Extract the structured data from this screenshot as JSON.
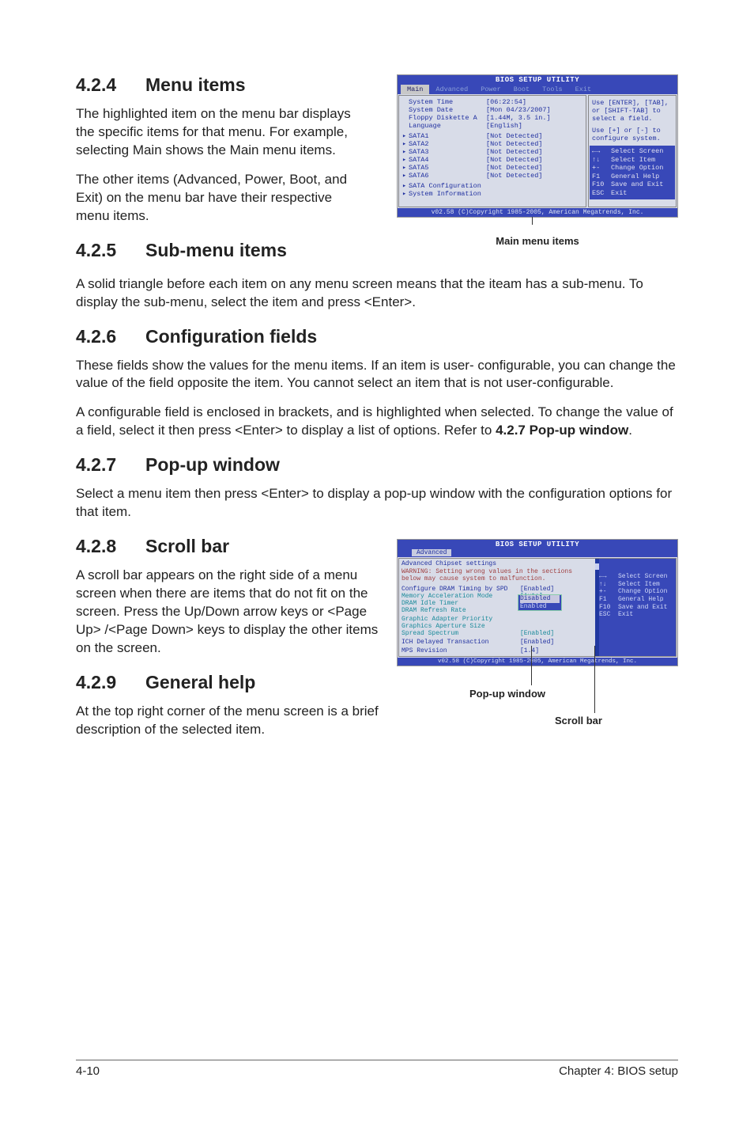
{
  "sections": {
    "s424": {
      "num": "4.2.4",
      "title": "Menu items",
      "p1": "The highlighted item on the menu bar displays the specific items for that menu. For example, selecting Main shows the Main menu items.",
      "p2": "The other items (Advanced, Power, Boot, and Exit) on the menu bar have their respective menu items."
    },
    "s425": {
      "num": "4.2.5",
      "title": "Sub-menu items",
      "p1": "A solid triangle before each item on any menu screen means that the iteam has a sub-menu. To display the sub-menu, select the item and press <Enter>."
    },
    "s426": {
      "num": "4.2.6",
      "title": "Configuration fields",
      "p1": "These fields show the values for the menu items. If an item is user- configurable, you can change the value of the field opposite the item. You cannot select an item that is not user-configurable.",
      "p2_a": "A configurable field is enclosed in brackets, and is highlighted when selected. To change the value of a field, select it then press <Enter> to display a list of options. Refer to ",
      "p2_b": "4.2.7 Pop-up window",
      "p2_c": "."
    },
    "s427": {
      "num": "4.2.7",
      "title": "Pop-up window",
      "p1": "Select a menu item then press <Enter> to display a pop-up window with the configuration options for that item."
    },
    "s428": {
      "num": "4.2.8",
      "title": "Scroll bar",
      "p1": "A scroll bar appears on the right side of a menu screen when there are items that do not fit on the screen. Press the Up/Down arrow keys or <Page Up> /<Page Down> keys to display the other items on the screen."
    },
    "s429": {
      "num": "4.2.9",
      "title": "General help",
      "p1": "At the top right corner of the menu screen is a brief description of the selected item."
    }
  },
  "bios1": {
    "title": "BIOS SETUP UTILITY",
    "tabs": [
      "Main",
      "Advanced",
      "Power",
      "Boot",
      "Tools",
      "Exit"
    ],
    "rows": [
      {
        "tri": "",
        "lbl": "System Time",
        "val": "[06:22:54]"
      },
      {
        "tri": "",
        "lbl": "System Date",
        "val": "[Mon 04/23/2007]"
      },
      {
        "tri": "",
        "lbl": "Floppy Diskette A",
        "val": "[1.44M, 3.5 in.]"
      },
      {
        "tri": "",
        "lbl": "Language",
        "val": "[English]"
      },
      {
        "tri": "▸",
        "lbl": "SATA1",
        "val": "[Not Detected]"
      },
      {
        "tri": "▸",
        "lbl": "SATA2",
        "val": "[Not Detected]"
      },
      {
        "tri": "▸",
        "lbl": "SATA3",
        "val": "[Not Detected]"
      },
      {
        "tri": "▸",
        "lbl": "SATA4",
        "val": "[Not Detected]"
      },
      {
        "tri": "▸",
        "lbl": "SATA5",
        "val": "[Not Detected]"
      },
      {
        "tri": "▸",
        "lbl": "SATA6",
        "val": "[Not Detected]"
      },
      {
        "tri": "▸",
        "lbl": "SATA Configuration",
        "val": ""
      },
      {
        "tri": "▸",
        "lbl": "System Information",
        "val": ""
      }
    ],
    "help1": "Use [ENTER], [TAB], or [SHIFT-TAB] to select a field.",
    "help2": "Use [+] or [-] to configure system.",
    "keys": [
      {
        "k": "←→",
        "d": "Select Screen"
      },
      {
        "k": "↑↓",
        "d": "Select Item"
      },
      {
        "k": "+-",
        "d": "Change Option"
      },
      {
        "k": "F1",
        "d": "General Help"
      },
      {
        "k": "F10",
        "d": "Save and Exit"
      },
      {
        "k": "ESC",
        "d": "Exit"
      }
    ],
    "footer": "v02.58 (C)Copyright 1985-2005, American Megatrends, Inc.",
    "caption": "Main menu items"
  },
  "bios2": {
    "title": "BIOS SETUP UTILITY",
    "tab": "Advanced",
    "heading": "Advanced Chipset settings",
    "warning": "WARNING: Setting wrong values in the sections below may cause system to malfunction.",
    "rows": [
      {
        "lbl": "Configure DRAM Timing by SPD",
        "val": "[Enabled]",
        "cls": ""
      },
      {
        "lbl": "Memory Acceleration Mode",
        "val": "[Auto]",
        "cls": "cyan"
      },
      {
        "lbl": "DRAM Idle Timer",
        "val": "",
        "cls": "cyan"
      },
      {
        "lbl": "DRAM Refresh Rate",
        "val": "",
        "cls": "cyan"
      },
      {
        "lbl": "Graphic Adapter Priority",
        "val": "",
        "cls": "cyan"
      },
      {
        "lbl": "Graphics Aperture Size",
        "val": "",
        "cls": "cyan"
      },
      {
        "lbl": "Spread Spectrum",
        "val": "[Enabled]",
        "cls": "cyan"
      },
      {
        "lbl": "ICH Delayed Transaction",
        "val": "[Enabled]",
        "cls": ""
      },
      {
        "lbl": "MPS Revision",
        "val": "[1.4]",
        "cls": ""
      }
    ],
    "popup": {
      "opt1": "Disabled",
      "opt2": "Enabled"
    },
    "keys": [
      {
        "k": "←→",
        "d": "Select Screen"
      },
      {
        "k": "↑↓",
        "d": "Select Item"
      },
      {
        "k": "+-",
        "d": "Change Option"
      },
      {
        "k": "F1",
        "d": "General Help"
      },
      {
        "k": "F10",
        "d": "Save and Exit"
      },
      {
        "k": "ESC",
        "d": "Exit"
      }
    ],
    "footer": "v02.58 (C)Copyright 1985-2005, American Megatrends, Inc.",
    "callout_popup": "Pop-up window",
    "callout_scroll": "Scroll bar"
  },
  "footer": {
    "left": "4-10",
    "right": "Chapter 4: BIOS setup"
  }
}
